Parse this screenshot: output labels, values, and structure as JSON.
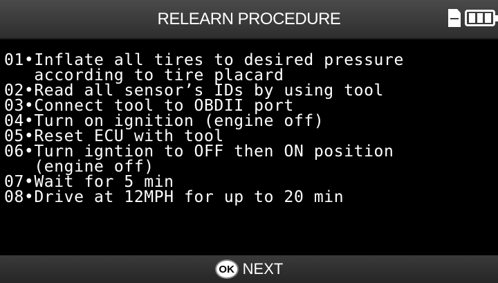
{
  "header": {
    "title": "RELEARN PROCEDURE",
    "icons": [
      "memory-card-icon",
      "battery-icon"
    ]
  },
  "procedure": {
    "lines": [
      "01•Inflate all tires to desired pressure",
      "   according to tire placard",
      "02•Read all sensor’s IDs by using tool",
      "03•Connect tool to OBDII port",
      "04•Turn on ignition (engine off)",
      "05•Reset ECU with tool",
      "06•Turn igntion to OFF then ON position",
      "   (engine off)",
      "07•Wait for 5 min",
      "08•Drive at 12MPH for up to 20 min"
    ]
  },
  "footer": {
    "ok_label": "OK",
    "next_label": "NEXT"
  }
}
